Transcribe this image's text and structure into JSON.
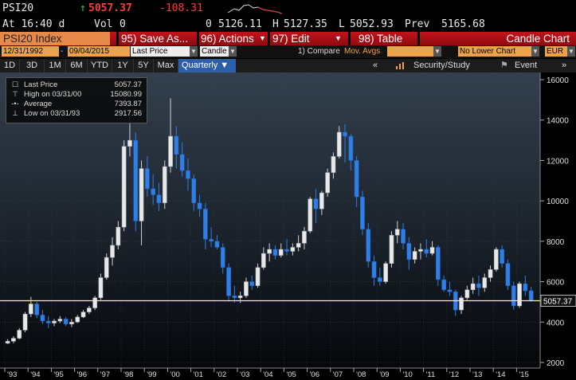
{
  "quote": {
    "ticker": "PSI20",
    "arrow": "↑",
    "last": "5057.37",
    "change": "-108.31",
    "time": "At 16:40 d",
    "vol_label": "Vol",
    "vol": "0",
    "open_label": "0",
    "open": "5126.11",
    "high_label": "H",
    "high": "5127.35",
    "low_label": "L",
    "low": "5052.93",
    "prev_label": "Prev",
    "prev": "5165.68"
  },
  "menu": {
    "title": "PSI20 Index",
    "save": "95) Save As...",
    "actions": "96) Actions",
    "edit": "97) Edit",
    "table": "98) Table",
    "chart_type": "Candle Chart"
  },
  "controls": {
    "start_date": "12/31/1992",
    "end_date": "09/04/2015",
    "price_field": "Last Price",
    "chart_style": "Candle",
    "compare_label": "1) Compare",
    "compare_value": "Mov. Avgs",
    "lower_chart": "No Lower Chart",
    "currency": "EUR"
  },
  "periods": {
    "items": [
      "1D",
      "3D",
      "1M",
      "6M",
      "YTD",
      "1Y",
      "5Y",
      "Max"
    ],
    "frequency": "Quarterly ▼",
    "back_arrows": "«",
    "security_study": "Security/Study",
    "event": "Event",
    "fwd_arrows": "»"
  },
  "legend": {
    "last_price_label": "Last Price",
    "last_price_value": "5057.37",
    "high_label": "High on 03/31/00",
    "high_value": "15080.99",
    "average_label": "Average",
    "average_value": "7393.87",
    "low_label": "Low on 03/31/93",
    "low_value": "2917.56"
  },
  "colors": {
    "up_candle": "#e8e8e8",
    "down_candle": "#2f7fe6",
    "last_price_line": "#ffff66",
    "menu_bar": "#b0141a",
    "positive": "#3ecf3e",
    "negative": "#ff3b3b"
  },
  "chart_data": {
    "type": "candlestick",
    "frequency": "Quarterly",
    "x_tick_labels": [
      "'93",
      "'94",
      "'95",
      "'96",
      "'97",
      "'98",
      "'99",
      "'00",
      "'01",
      "'02",
      "'03",
      "'04",
      "'05",
      "'06",
      "'07",
      "'08",
      "'09",
      "'10",
      "'11",
      "'12",
      "'13",
      "'14",
      "'15"
    ],
    "y_ticks": [
      2000,
      4000,
      6000,
      8000,
      10000,
      12000,
      14000,
      16000
    ],
    "ylim": [
      1800,
      16400
    ],
    "last_price_line": 5057.37,
    "last_price_label": "5057.37",
    "series": [
      {
        "q": "1993Q1",
        "o": 2950,
        "h": 3150,
        "l": 2917,
        "c": 3050
      },
      {
        "q": "1993Q2",
        "o": 3050,
        "h": 3300,
        "l": 2950,
        "c": 3200
      },
      {
        "q": "1993Q3",
        "o": 3200,
        "h": 3700,
        "l": 3150,
        "c": 3600
      },
      {
        "q": "1993Q4",
        "o": 3600,
        "h": 4500,
        "l": 3500,
        "c": 4400
      },
      {
        "q": "1994Q1",
        "o": 4400,
        "h": 5250,
        "l": 4250,
        "c": 4900
      },
      {
        "q": "1994Q2",
        "o": 4900,
        "h": 5000,
        "l": 4200,
        "c": 4350
      },
      {
        "q": "1994Q3",
        "o": 4350,
        "h": 4600,
        "l": 3900,
        "c": 4050
      },
      {
        "q": "1994Q4",
        "o": 4050,
        "h": 4300,
        "l": 3700,
        "c": 3950
      },
      {
        "q": "1995Q1",
        "o": 3950,
        "h": 4150,
        "l": 3800,
        "c": 4050
      },
      {
        "q": "1995Q2",
        "o": 4050,
        "h": 4300,
        "l": 3950,
        "c": 4150
      },
      {
        "q": "1995Q3",
        "o": 4150,
        "h": 4250,
        "l": 3800,
        "c": 3900
      },
      {
        "q": "1995Q4",
        "o": 3900,
        "h": 4150,
        "l": 3750,
        "c": 4000
      },
      {
        "q": "1996Q1",
        "o": 4000,
        "h": 4350,
        "l": 3950,
        "c": 4250
      },
      {
        "q": "1996Q2",
        "o": 4250,
        "h": 4600,
        "l": 4200,
        "c": 4500
      },
      {
        "q": "1996Q3",
        "o": 4500,
        "h": 4800,
        "l": 4400,
        "c": 4700
      },
      {
        "q": "1996Q4",
        "o": 4700,
        "h": 5300,
        "l": 4600,
        "c": 5200
      },
      {
        "q": "1997Q1",
        "o": 5200,
        "h": 6400,
        "l": 5100,
        "c": 6200
      },
      {
        "q": "1997Q2",
        "o": 6200,
        "h": 7400,
        "l": 6100,
        "c": 7200
      },
      {
        "q": "1997Q3",
        "o": 7200,
        "h": 8200,
        "l": 6800,
        "c": 7800
      },
      {
        "q": "1997Q4",
        "o": 7800,
        "h": 9000,
        "l": 7600,
        "c": 8700
      },
      {
        "q": "1998Q1",
        "o": 8700,
        "h": 13000,
        "l": 8500,
        "c": 12700
      },
      {
        "q": "1998Q2",
        "o": 12700,
        "h": 14500,
        "l": 12200,
        "c": 13000
      },
      {
        "q": "1998Q3",
        "o": 13000,
        "h": 13400,
        "l": 8500,
        "c": 9000
      },
      {
        "q": "1998Q4",
        "o": 9000,
        "h": 12000,
        "l": 7800,
        "c": 11600
      },
      {
        "q": "1999Q1",
        "o": 11600,
        "h": 12200,
        "l": 10200,
        "c": 10600
      },
      {
        "q": "1999Q2",
        "o": 10600,
        "h": 11300,
        "l": 9800,
        "c": 10300
      },
      {
        "q": "1999Q3",
        "o": 10300,
        "h": 10900,
        "l": 9500,
        "c": 9900
      },
      {
        "q": "1999Q4",
        "o": 9900,
        "h": 12000,
        "l": 9600,
        "c": 11700
      },
      {
        "q": "2000Q1",
        "o": 11700,
        "h": 15080,
        "l": 11400,
        "c": 13200
      },
      {
        "q": "2000Q2",
        "o": 13200,
        "h": 13700,
        "l": 11600,
        "c": 12300
      },
      {
        "q": "2000Q3",
        "o": 12300,
        "h": 12900,
        "l": 11200,
        "c": 11500
      },
      {
        "q": "2000Q4",
        "o": 11500,
        "h": 12100,
        "l": 10500,
        "c": 11100
      },
      {
        "q": "2001Q1",
        "o": 11100,
        "h": 11300,
        "l": 9500,
        "c": 9900
      },
      {
        "q": "2001Q2",
        "o": 9900,
        "h": 10300,
        "l": 9200,
        "c": 9600
      },
      {
        "q": "2001Q3",
        "o": 9600,
        "h": 9900,
        "l": 7600,
        "c": 8100
      },
      {
        "q": "2001Q4",
        "o": 8100,
        "h": 8700,
        "l": 7700,
        "c": 8000
      },
      {
        "q": "2002Q1",
        "o": 8000,
        "h": 8300,
        "l": 7600,
        "c": 7700
      },
      {
        "q": "2002Q2",
        "o": 7700,
        "h": 7900,
        "l": 6400,
        "c": 6700
      },
      {
        "q": "2002Q3",
        "o": 6700,
        "h": 6900,
        "l": 5000,
        "c": 5300
      },
      {
        "q": "2002Q4",
        "o": 5300,
        "h": 5800,
        "l": 4950,
        "c": 5200
      },
      {
        "q": "2003Q1",
        "o": 5200,
        "h": 5500,
        "l": 4950,
        "c": 5300
      },
      {
        "q": "2003Q2",
        "o": 5300,
        "h": 6200,
        "l": 5200,
        "c": 6000
      },
      {
        "q": "2003Q3",
        "o": 6000,
        "h": 6300,
        "l": 5600,
        "c": 5800
      },
      {
        "q": "2003Q4",
        "o": 5800,
        "h": 6900,
        "l": 5700,
        "c": 6700
      },
      {
        "q": "2004Q1",
        "o": 6700,
        "h": 7700,
        "l": 6600,
        "c": 7400
      },
      {
        "q": "2004Q2",
        "o": 7400,
        "h": 7900,
        "l": 7000,
        "c": 7600
      },
      {
        "q": "2004Q3",
        "o": 7600,
        "h": 7800,
        "l": 7100,
        "c": 7300
      },
      {
        "q": "2004Q4",
        "o": 7300,
        "h": 7900,
        "l": 7200,
        "c": 7600
      },
      {
        "q": "2005Q1",
        "o": 7600,
        "h": 8100,
        "l": 7300,
        "c": 7500
      },
      {
        "q": "2005Q2",
        "o": 7500,
        "h": 7900,
        "l": 7300,
        "c": 7700
      },
      {
        "q": "2005Q3",
        "o": 7700,
        "h": 8300,
        "l": 7500,
        "c": 7900
      },
      {
        "q": "2005Q4",
        "o": 7900,
        "h": 8700,
        "l": 7600,
        "c": 8500
      },
      {
        "q": "2006Q1",
        "o": 8500,
        "h": 10200,
        "l": 8400,
        "c": 10100
      },
      {
        "q": "2006Q2",
        "o": 10100,
        "h": 10600,
        "l": 8900,
        "c": 9600
      },
      {
        "q": "2006Q3",
        "o": 9600,
        "h": 10500,
        "l": 9300,
        "c": 10400
      },
      {
        "q": "2006Q4",
        "o": 10400,
        "h": 11600,
        "l": 10200,
        "c": 11400
      },
      {
        "q": "2007Q1",
        "o": 11400,
        "h": 12400,
        "l": 11100,
        "c": 12200
      },
      {
        "q": "2007Q2",
        "o": 12200,
        "h": 13700,
        "l": 12100,
        "c": 13400
      },
      {
        "q": "2007Q3",
        "o": 13400,
        "h": 13800,
        "l": 11900,
        "c": 13200
      },
      {
        "q": "2007Q4",
        "o": 13200,
        "h": 13300,
        "l": 11500,
        "c": 12000
      },
      {
        "q": "2008Q1",
        "o": 12000,
        "h": 12200,
        "l": 9700,
        "c": 10200
      },
      {
        "q": "2008Q2",
        "o": 10200,
        "h": 10500,
        "l": 8300,
        "c": 8600
      },
      {
        "q": "2008Q3",
        "o": 8600,
        "h": 8900,
        "l": 6700,
        "c": 7000
      },
      {
        "q": "2008Q4",
        "o": 7000,
        "h": 7300,
        "l": 5800,
        "c": 6200
      },
      {
        "q": "2009Q1",
        "o": 6200,
        "h": 6700,
        "l": 5800,
        "c": 6000
      },
      {
        "q": "2009Q2",
        "o": 6000,
        "h": 7000,
        "l": 5900,
        "c": 6900
      },
      {
        "q": "2009Q3",
        "o": 6900,
        "h": 8500,
        "l": 6700,
        "c": 8300
      },
      {
        "q": "2009Q4",
        "o": 8300,
        "h": 9000,
        "l": 7900,
        "c": 8600
      },
      {
        "q": "2010Q1",
        "o": 8600,
        "h": 8900,
        "l": 7600,
        "c": 7900
      },
      {
        "q": "2010Q2",
        "o": 7900,
        "h": 8200,
        "l": 6600,
        "c": 7100
      },
      {
        "q": "2010Q3",
        "o": 7100,
        "h": 7700,
        "l": 6900,
        "c": 7500
      },
      {
        "q": "2010Q4",
        "o": 7500,
        "h": 7900,
        "l": 7100,
        "c": 7600
      },
      {
        "q": "2011Q1",
        "o": 7600,
        "h": 8100,
        "l": 7200,
        "c": 7400
      },
      {
        "q": "2011Q2",
        "o": 7400,
        "h": 8000,
        "l": 7300,
        "c": 7700
      },
      {
        "q": "2011Q3",
        "o": 7700,
        "h": 7800,
        "l": 5800,
        "c": 6100
      },
      {
        "q": "2011Q4",
        "o": 6100,
        "h": 6300,
        "l": 5500,
        "c": 5600
      },
      {
        "q": "2012Q1",
        "o": 5600,
        "h": 6000,
        "l": 5300,
        "c": 5500
      },
      {
        "q": "2012Q2",
        "o": 5500,
        "h": 5600,
        "l": 4300,
        "c": 4600
      },
      {
        "q": "2012Q3",
        "o": 4600,
        "h": 5300,
        "l": 4400,
        "c": 5200
      },
      {
        "q": "2012Q4",
        "o": 5200,
        "h": 5800,
        "l": 5100,
        "c": 5600
      },
      {
        "q": "2013Q1",
        "o": 5600,
        "h": 6200,
        "l": 5400,
        "c": 5900
      },
      {
        "q": "2013Q2",
        "o": 5900,
        "h": 6300,
        "l": 5300,
        "c": 5700
      },
      {
        "q": "2013Q3",
        "o": 5700,
        "h": 6400,
        "l": 5500,
        "c": 6200
      },
      {
        "q": "2013Q4",
        "o": 6200,
        "h": 6800,
        "l": 6000,
        "c": 6600
      },
      {
        "q": "2014Q1",
        "o": 6600,
        "h": 7700,
        "l": 6500,
        "c": 7600
      },
      {
        "q": "2014Q2",
        "o": 7600,
        "h": 7800,
        "l": 6700,
        "c": 6900
      },
      {
        "q": "2014Q3",
        "o": 6900,
        "h": 7100,
        "l": 5600,
        "c": 5800
      },
      {
        "q": "2014Q4",
        "o": 5800,
        "h": 6000,
        "l": 4600,
        "c": 4800
      },
      {
        "q": "2015Q1",
        "o": 4800,
        "h": 6000,
        "l": 4700,
        "c": 5900
      },
      {
        "q": "2015Q2",
        "o": 5900,
        "h": 6300,
        "l": 5300,
        "c": 5550
      },
      {
        "q": "2015Q3",
        "o": 5550,
        "h": 5750,
        "l": 5000,
        "c": 5057
      }
    ]
  }
}
